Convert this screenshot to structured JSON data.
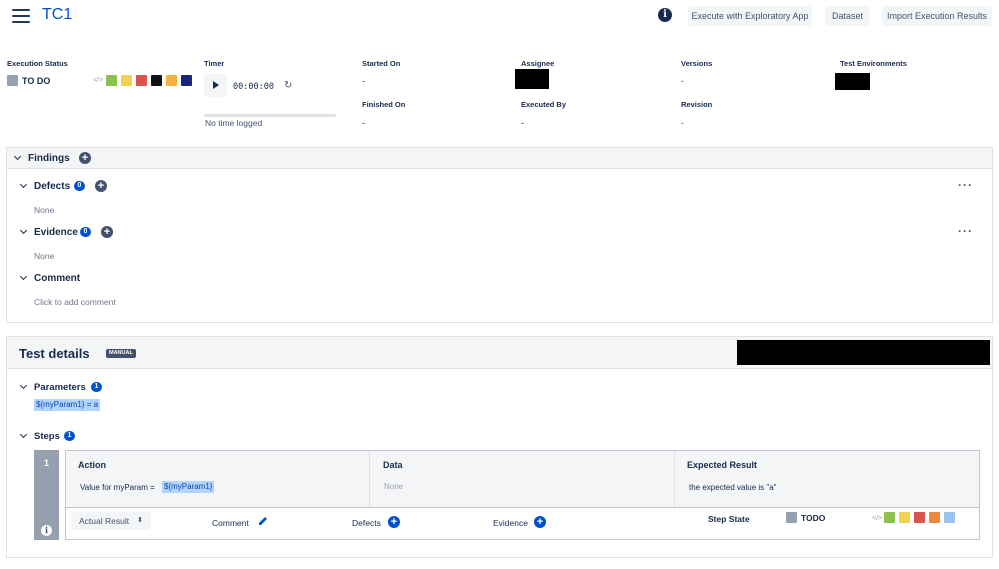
{
  "header": {
    "title": "TC1",
    "buttons": {
      "execute": "Execute with Exploratory App",
      "dataset": "Dataset",
      "import": "Import Execution Results"
    }
  },
  "info": {
    "execution_status_label": "Execution Status",
    "execution_status": "TO DO",
    "timer_label": "Timer",
    "timer_value": "00:00:00",
    "timer_note": "No time logged",
    "timer_progress": 0,
    "started_on_label": "Started On",
    "started_on": "-",
    "finished_on_label": "Finished On",
    "finished_on": "-",
    "assignee_label": "Assignee",
    "executed_by_label": "Executed By",
    "executed_by": "-",
    "versions_label": "Versions",
    "versions": "-",
    "revision_label": "Revision",
    "revision": "-",
    "test_environments_label": "Test Environments",
    "status_colors": [
      "#8fbf4f",
      "#f1d14f",
      "#d9534f",
      "#111111",
      "#f5b041",
      "#1a237e"
    ]
  },
  "findings": {
    "title": "Findings",
    "defects_label": "Defects",
    "defects_count": "0",
    "defects_value": "None",
    "evidence_label": "Evidence",
    "evidence_count": "0",
    "evidence_value": "None",
    "comment_label": "Comment",
    "comment_placeholder": "Click to add comment"
  },
  "test_details": {
    "title": "Test details",
    "badge": "MANUAL",
    "parameters_label": "Parameters",
    "parameters_count": "1",
    "parameter": "${myParam1} = a",
    "steps_label": "Steps",
    "steps_count": "1"
  },
  "step": {
    "number": "1",
    "action_header": "Action",
    "action_text": "Value for myParam = ",
    "action_param": "${myParam1}",
    "data_header": "Data",
    "data_value": "None",
    "expected_header": "Expected Result",
    "expected_value": "the expected value is \"a\"",
    "actual_result_label": "Actual Result",
    "comment_label": "Comment",
    "defects_label": "Defects",
    "evidence_label": "Evidence",
    "step_state_label": "Step State",
    "step_state": "TODO",
    "state_colors": [
      "#8fbf4f",
      "#f1d14f",
      "#d9534f",
      "#f0883e",
      "#9cc3f0"
    ]
  }
}
